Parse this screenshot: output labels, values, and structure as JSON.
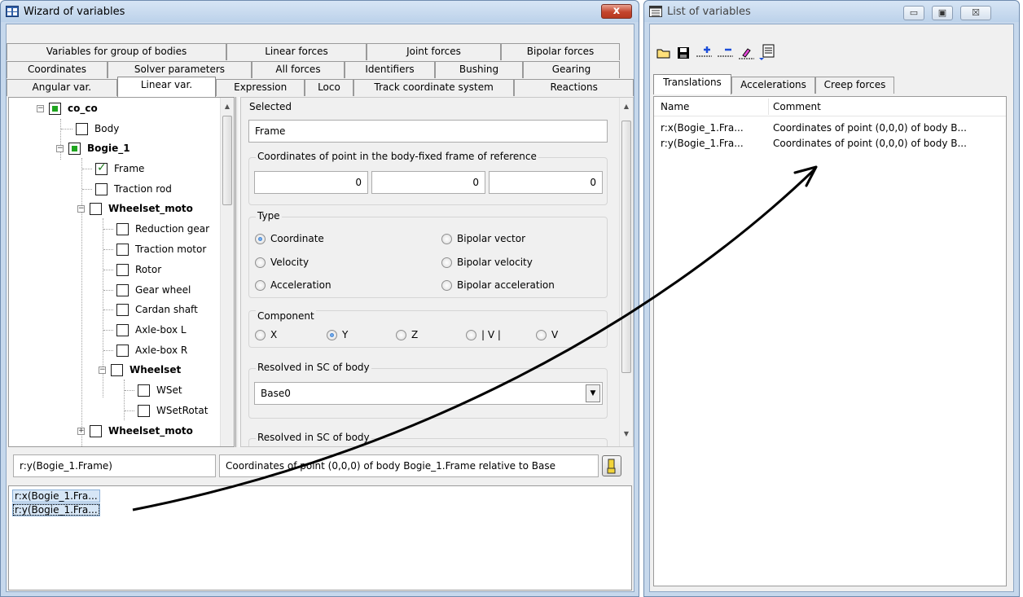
{
  "wizard": {
    "title": "Wizard of variables",
    "close_glyph": "x",
    "tabs_row1": [
      "Variables for group of bodies",
      "Linear forces",
      "Joint forces",
      "Bipolar forces"
    ],
    "tabs_row2": [
      "Coordinates",
      "Solver parameters",
      "All forces",
      "Identifiers",
      "Bushing",
      "Gearing"
    ],
    "tabs_row3": [
      "Angular var.",
      "Linear var.",
      "Expression",
      "Loco",
      "Track coordinate system",
      "Reactions"
    ],
    "tree": [
      {
        "label": "co_co",
        "bold": true,
        "state": "partial",
        "expander": "−"
      },
      {
        "label": "Body",
        "bold": false,
        "state": "unchecked",
        "expander": ""
      },
      {
        "label": "Bogie_1",
        "bold": true,
        "state": "partial",
        "expander": "−"
      },
      {
        "label": "Frame",
        "bold": false,
        "state": "checked",
        "expander": ""
      },
      {
        "label": "Traction rod",
        "bold": false,
        "state": "unchecked",
        "expander": ""
      },
      {
        "label": "Wheelset_moto",
        "bold": true,
        "state": "unchecked",
        "expander": "−"
      },
      {
        "label": "Reduction gear",
        "bold": false,
        "state": "unchecked",
        "expander": ""
      },
      {
        "label": "Traction motor",
        "bold": false,
        "state": "unchecked",
        "expander": ""
      },
      {
        "label": "Rotor",
        "bold": false,
        "state": "unchecked",
        "expander": ""
      },
      {
        "label": "Gear wheel",
        "bold": false,
        "state": "unchecked",
        "expander": ""
      },
      {
        "label": "Cardan shaft",
        "bold": false,
        "state": "unchecked",
        "expander": ""
      },
      {
        "label": "Axle-box L",
        "bold": false,
        "state": "unchecked",
        "expander": ""
      },
      {
        "label": "Axle-box R",
        "bold": false,
        "state": "unchecked",
        "expander": ""
      },
      {
        "label": "Wheelset",
        "bold": true,
        "state": "unchecked",
        "expander": "−"
      },
      {
        "label": "WSet",
        "bold": false,
        "state": "unchecked",
        "expander": ""
      },
      {
        "label": "WSetRotat",
        "bold": false,
        "state": "unchecked",
        "expander": ""
      },
      {
        "label": "Wheelset_moto",
        "bold": true,
        "state": "unchecked",
        "expander": "+"
      }
    ],
    "selected_label": "Selected",
    "selected_value": "Frame",
    "coords_group_label": "Coordinates of point in the body-fixed frame of reference",
    "coords": [
      "0",
      "0",
      "0"
    ],
    "type_group_label": "Type",
    "type_options": [
      "Coordinate",
      "Bipolar vector",
      "Velocity",
      "Bipolar velocity",
      "Acceleration",
      "Bipolar acceleration"
    ],
    "type_selected": "Coordinate",
    "component_group_label": "Component",
    "component_options": [
      "X",
      "Y",
      "Z",
      "| V |",
      "V"
    ],
    "component_selected": "Y",
    "resolved_label_1": "Resolved in SC of body",
    "resolved_value_1": "Base0",
    "resolved_label_2": "Resolved in SC of body",
    "var_name": "r:y(Bogie_1.Frame)",
    "var_comment": "Coordinates of point (0,0,0) of body Bogie_1.Frame relative to Base",
    "list_items": [
      "r:x(Bogie_1.Fra...",
      "r:y(Bogie_1.Fra..."
    ]
  },
  "list_window": {
    "title": "List of variables",
    "minimize_glyph": "▭",
    "maximize_glyph": "▣",
    "close_glyph": "☒",
    "tabs": [
      "Translations",
      "Accelerations",
      "Creep forces"
    ],
    "columns": [
      "Name",
      "Comment"
    ],
    "rows": [
      {
        "name": "r:x(Bogie_1.Fra...",
        "comment": "Coordinates of point (0,0,0) of body B..."
      },
      {
        "name": "r:y(Bogie_1.Fra...",
        "comment": "Coordinates of point (0,0,0) of body B..."
      }
    ]
  }
}
